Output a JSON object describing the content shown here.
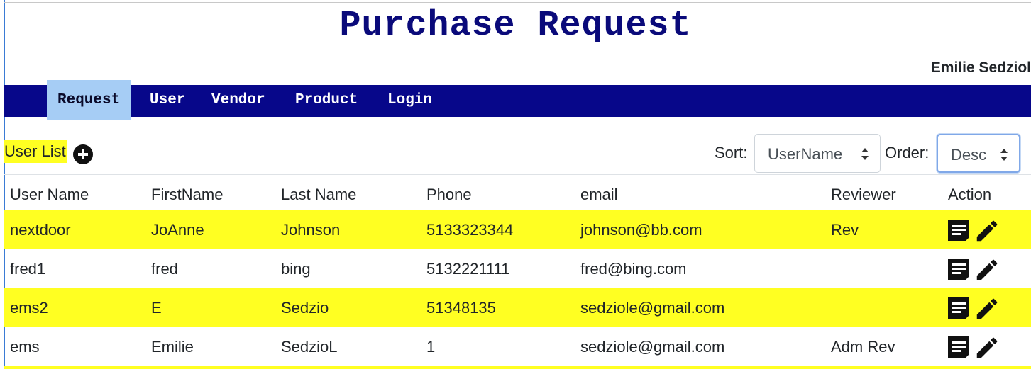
{
  "app": {
    "title": "Purchase Request",
    "current_user": "Emilie Sedziol"
  },
  "nav": {
    "items": [
      {
        "label": "Request",
        "active": true
      },
      {
        "label": "User",
        "active": false
      },
      {
        "label": "Vendor",
        "active": false
      },
      {
        "label": "Product",
        "active": false
      },
      {
        "label": "Login",
        "active": false
      }
    ]
  },
  "toolbar": {
    "list_title": "User List",
    "add_icon": "plus-circle-icon",
    "sort_label": "Sort:",
    "sort_value": "UserName",
    "order_label": "Order:",
    "order_value": "Desc"
  },
  "table": {
    "columns": [
      "User Name",
      "FirstName",
      "Last Name",
      "Phone",
      "email",
      "Reviewer",
      "Action"
    ],
    "rows": [
      {
        "username": "nextdoor",
        "firstname": "JoAnne",
        "lastname": "Johnson",
        "phone": "5133323344",
        "email": "johnson@bb.com",
        "reviewer": "Rev"
      },
      {
        "username": "fred1",
        "firstname": "fred",
        "lastname": "bing",
        "phone": "5132221111",
        "email": "fred@bing.com",
        "reviewer": ""
      },
      {
        "username": "ems2",
        "firstname": "E",
        "lastname": "Sedzio",
        "phone": "51348135",
        "email": "sedziole@gmail.com",
        "reviewer": ""
      },
      {
        "username": "ems",
        "firstname": "Emilie",
        "lastname": "SedzioL",
        "phone": "1",
        "email": "sedziole@gmail.com",
        "reviewer": "Adm Rev"
      }
    ],
    "action_icons": [
      "detail-icon",
      "edit-pencil-icon"
    ]
  },
  "colors": {
    "navbar": "#07078a",
    "title": "#0a0a7a",
    "highlight": "#ffff22",
    "active_tab": "#a6cdf5"
  }
}
